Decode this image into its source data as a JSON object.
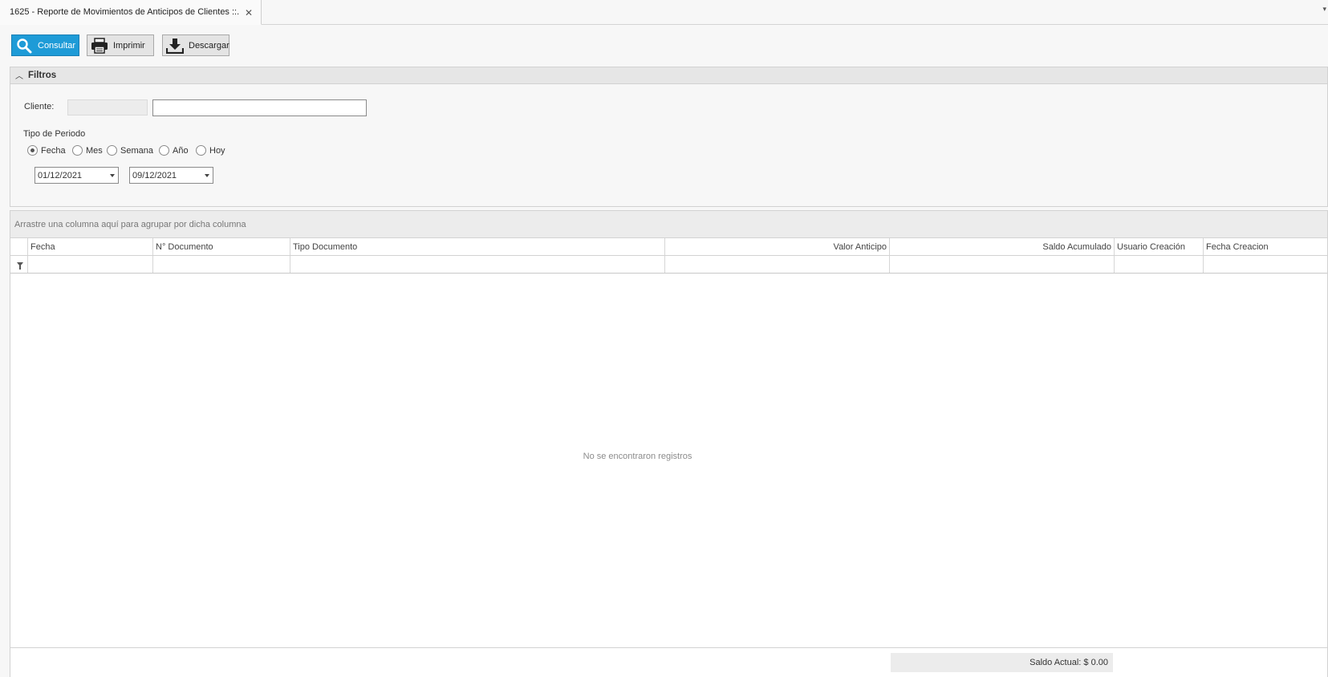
{
  "tab": {
    "title": "1625 - Reporte de Movimientos de Anticipos de Clientes ::.",
    "close_glyph": "✕"
  },
  "toolbar": {
    "consultar_label": "Consultar",
    "imprimir_label": "Imprimir",
    "descargar_label": "Descargar",
    "consultar_color": "#1e9bd7"
  },
  "filters": {
    "title": "Filtros",
    "cliente_label": "Cliente:",
    "cliente_code": "",
    "cliente_name": "",
    "periodo_label": "Tipo de Periodo",
    "period_options": [
      {
        "label": "Fecha",
        "selected": true
      },
      {
        "label": "Mes",
        "selected": false
      },
      {
        "label": "Semana",
        "selected": false
      },
      {
        "label": "Año",
        "selected": false
      },
      {
        "label": "Hoy",
        "selected": false
      }
    ],
    "date_from": "01/12/2021",
    "date_to": "09/12/2021"
  },
  "grid": {
    "group_panel_text": "Arrastre una columna aquí para agrupar por dicha columna",
    "columns": [
      "Fecha",
      "N° Documento",
      "Tipo Documento",
      "Valor Anticipo",
      "Saldo Acumulado",
      "Usuario Creación",
      "Fecha Creacion"
    ],
    "empty_message": "No se encontraron registros",
    "footer": {
      "saldo_actual": "Saldo Actual: $ 0.00"
    }
  }
}
